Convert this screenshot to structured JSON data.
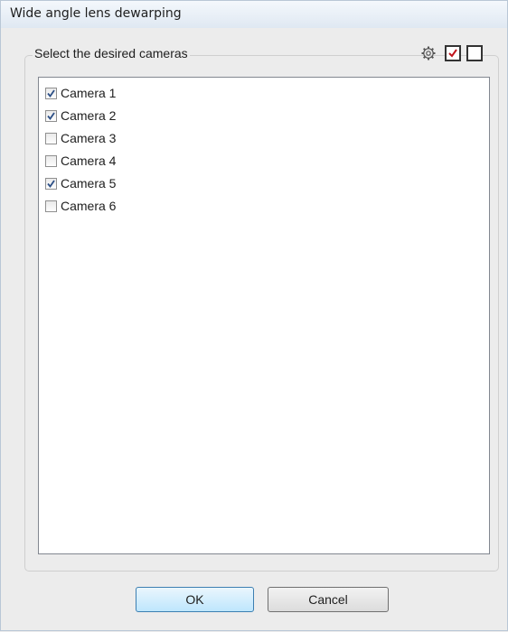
{
  "window": {
    "title": "Wide angle lens dewarping"
  },
  "group": {
    "title": "Select the desired cameras"
  },
  "toolbar": {
    "icons": [
      "gear-icon",
      "check-all-icon",
      "uncheck-all-icon"
    ]
  },
  "cameras": [
    {
      "label": "Camera 1",
      "checked": true
    },
    {
      "label": "Camera 2",
      "checked": true
    },
    {
      "label": "Camera 3",
      "checked": false
    },
    {
      "label": "Camera 4",
      "checked": false
    },
    {
      "label": "Camera 5",
      "checked": true
    },
    {
      "label": "Camera 6",
      "checked": false
    }
  ],
  "buttons": {
    "ok": "OK",
    "cancel": "Cancel"
  },
  "colors": {
    "check": "#2c4f86",
    "accent_border": "#3c7fb1"
  }
}
